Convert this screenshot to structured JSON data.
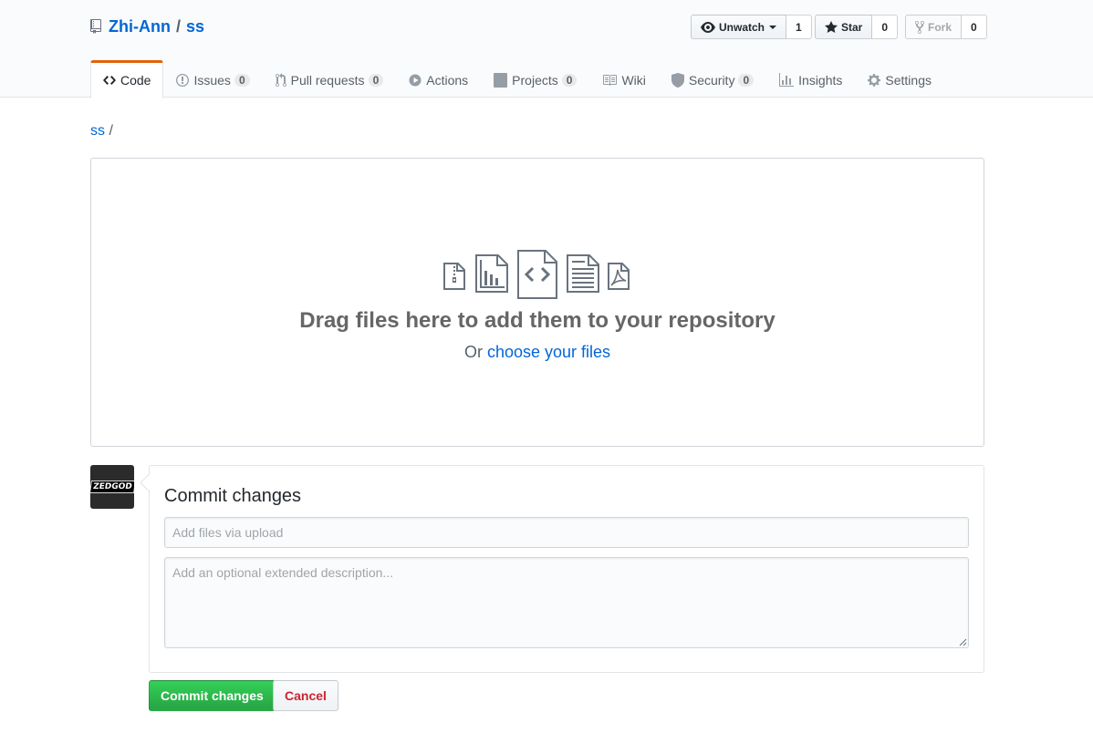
{
  "repo": {
    "owner": "Zhi-Ann",
    "separator": "/",
    "name": "ss",
    "icon": "repo-icon"
  },
  "actions": {
    "watch": {
      "label": "Unwatch",
      "count": "1",
      "icon": "eye-icon"
    },
    "star": {
      "label": "Star",
      "count": "0",
      "icon": "star-icon"
    },
    "fork": {
      "label": "Fork",
      "count": "0",
      "icon": "fork-icon"
    }
  },
  "nav": {
    "code": {
      "label": "Code",
      "icon": "code-icon"
    },
    "issues": {
      "label": "Issues",
      "count": "0",
      "icon": "issue-icon"
    },
    "pulls": {
      "label": "Pull requests",
      "count": "0",
      "icon": "pull-request-icon"
    },
    "actions": {
      "label": "Actions",
      "icon": "play-icon"
    },
    "projects": {
      "label": "Projects",
      "count": "0",
      "icon": "project-icon"
    },
    "wiki": {
      "label": "Wiki",
      "icon": "book-icon"
    },
    "security": {
      "label": "Security",
      "count": "0",
      "icon": "shield-icon"
    },
    "insights": {
      "label": "Insights",
      "icon": "graph-icon"
    },
    "settings": {
      "label": "Settings",
      "icon": "gear-icon"
    }
  },
  "breadcrumb": {
    "repo": "ss",
    "separator": "/"
  },
  "dropzone": {
    "title": "Drag files here to add them to your repository",
    "prefix": "Or",
    "link": "choose your files",
    "icons": [
      "file-zip-icon",
      "file-chart-icon",
      "file-code-icon",
      "file-text-icon",
      "file-pdf-icon"
    ]
  },
  "commit": {
    "avatar_text": "ZEDGOD",
    "title": "Commit changes",
    "summary_placeholder": "Add files via upload",
    "description_placeholder": "Add an optional extended description...",
    "submit_label": "Commit changes",
    "cancel_label": "Cancel"
  },
  "colors": {
    "link": "#0366d6",
    "primary": "#28a745",
    "danger": "#cb2431",
    "selected_tab_accent": "#e36209"
  }
}
